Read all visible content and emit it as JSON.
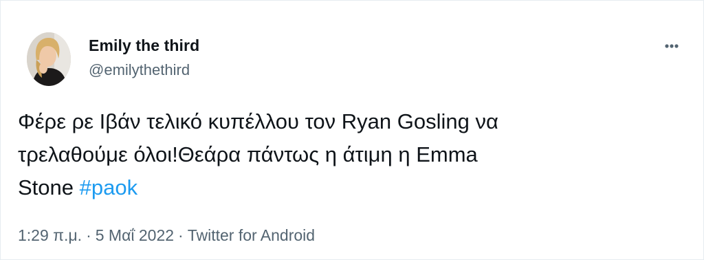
{
  "author": {
    "display_name": "Emily the third",
    "handle": "@emilythethird"
  },
  "icons": {
    "avatar": "profile-photo",
    "more": "more-horizontal-icon"
  },
  "tweet": {
    "line1": "Φέρε ρε Ιβάν τελικό κυπέλλου τον Ryan Gosling να",
    "line2": "τρελαθούμε όλοι!Θεάρα πάντως η άτιμη η Emma",
    "line3_text": "Stone ",
    "hashtag": "#paok"
  },
  "meta": {
    "time": "1:29 π.μ.",
    "separator": "·",
    "date": "5 Μαΐ 2022",
    "source": "Twitter for Android"
  },
  "colors": {
    "text": "#0f1419",
    "secondary": "#536471",
    "link": "#1d9bf0",
    "border": "#e6ecf0"
  }
}
